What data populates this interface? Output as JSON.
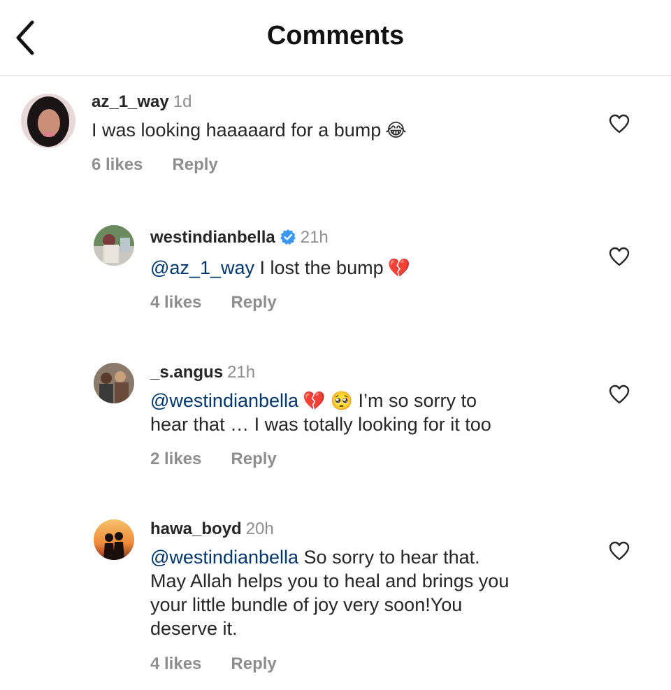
{
  "header": {
    "title": "Comments"
  },
  "comments": [
    {
      "username": "az_1_way",
      "time": "1d",
      "text": "I was looking haaaaard for a bump",
      "emoji": "😂",
      "likes": "6 likes",
      "reply": "Reply"
    },
    {
      "username": "westindianbella",
      "verified": true,
      "time": "21h",
      "mention": "@az_1_way",
      "text": " I lost the bump",
      "emoji": "💔",
      "likes": "4 likes",
      "reply": "Reply"
    },
    {
      "username": "_s.angus",
      "time": "21h",
      "mention": "@westindianbella",
      "emoji": "💔 🥺",
      "text_line1": " I’m so sorry to",
      "text_line2": "hear that … I was totally looking for it too",
      "likes": "2 likes",
      "reply": "Reply"
    },
    {
      "username": "hawa_boyd",
      "time": "20h",
      "mention": "@westindianbella",
      "text_line1": " So sorry to hear that.",
      "text_line2": "May Allah helps you to heal and brings you",
      "text_line3": "your little bundle of joy very soon!You",
      "text_line4": "deserve it.",
      "likes": "4 likes",
      "reply": "Reply"
    }
  ],
  "colors": {
    "mention": "#00376b",
    "muted": "#8e8e8e",
    "verified": "#3897f0"
  }
}
